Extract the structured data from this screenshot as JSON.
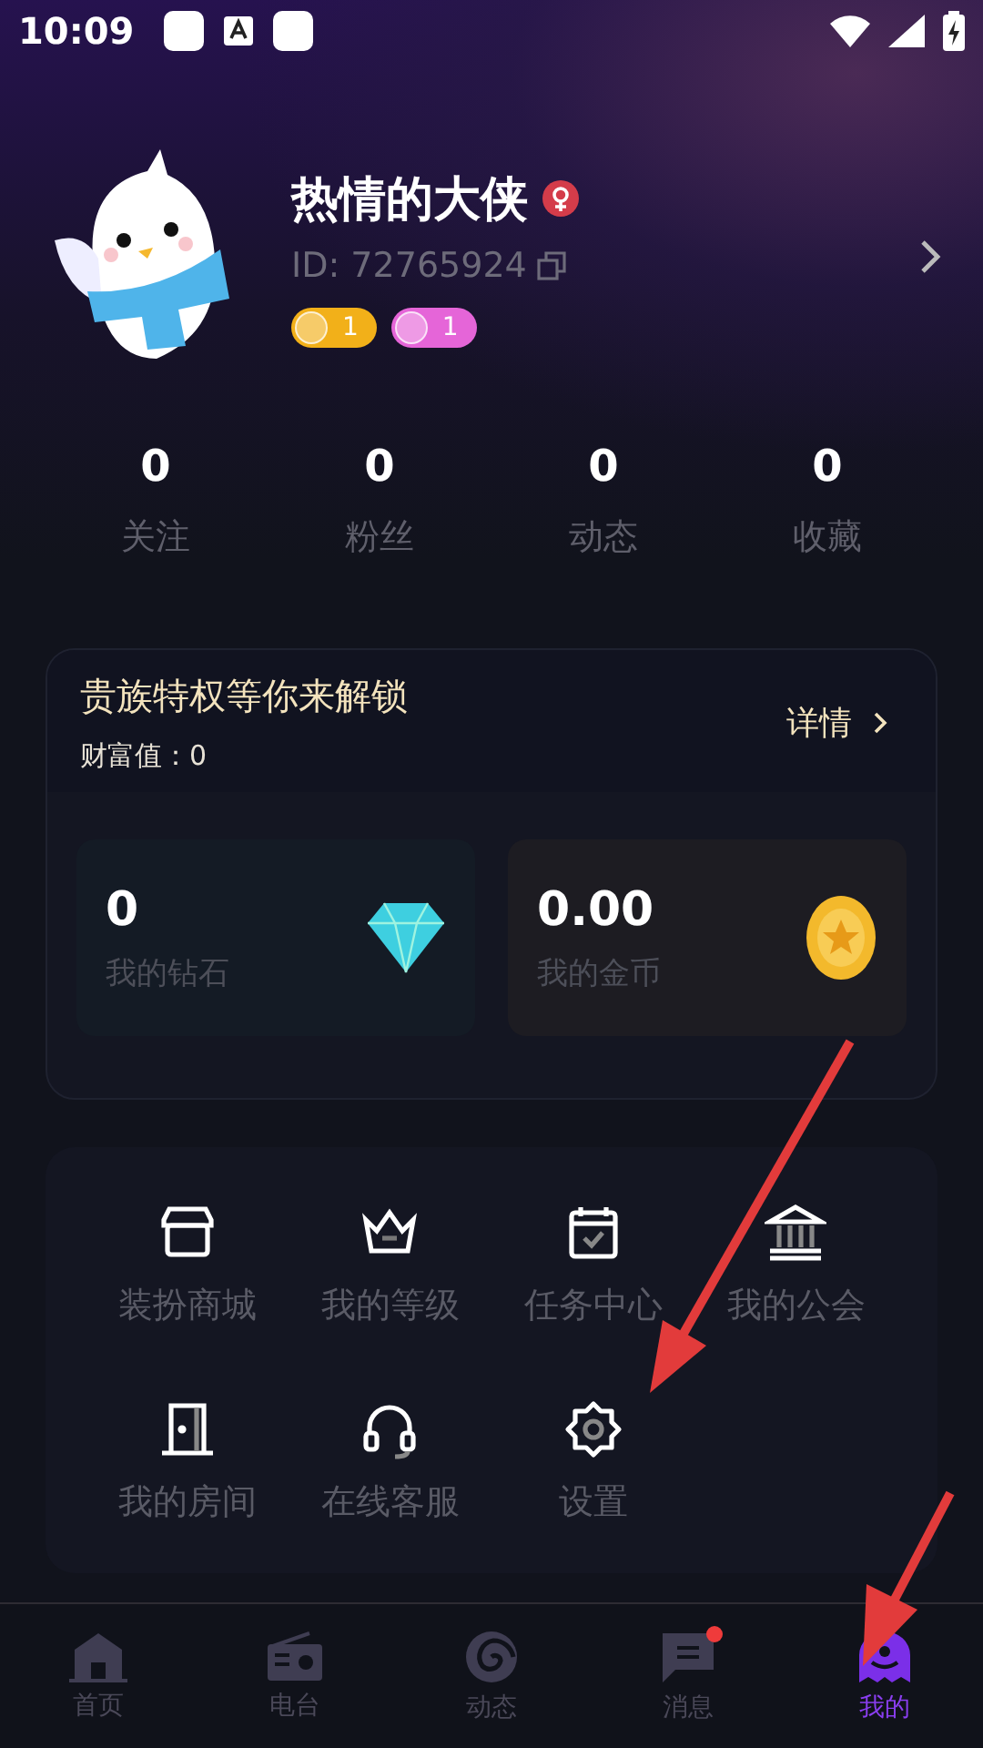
{
  "status_bar": {
    "time": "10:09"
  },
  "profile": {
    "name": "热情的大侠",
    "id": "ID: 72765924",
    "badges": [
      {
        "label": "1",
        "color": "#f2b019"
      },
      {
        "label": "1",
        "color": "#e565d8"
      }
    ]
  },
  "stats": [
    {
      "value": "0",
      "label": "关注"
    },
    {
      "value": "0",
      "label": "粉丝"
    },
    {
      "value": "0",
      "label": "动态"
    },
    {
      "value": "0",
      "label": "收藏"
    }
  ],
  "privilege_card": {
    "title": "贵族特权等你来解锁",
    "wealth": "财富值：0",
    "details": "详情"
  },
  "wallet": [
    {
      "kind": "diamond",
      "value": "0",
      "label": "我的钻石"
    },
    {
      "kind": "coin",
      "value": "0.00",
      "label": "我的金币"
    }
  ],
  "menu": [
    {
      "label": "装扮商城"
    },
    {
      "label": "我的等级"
    },
    {
      "label": "任务中心"
    },
    {
      "label": "我的公会"
    },
    {
      "label": "我的房间"
    },
    {
      "label": "在线客服"
    },
    {
      "label": "设置"
    }
  ],
  "nav": [
    {
      "label": "首页",
      "selected": false,
      "dot": false
    },
    {
      "label": "电台",
      "selected": false,
      "dot": false
    },
    {
      "label": "动态",
      "selected": false,
      "dot": false
    },
    {
      "label": "消息",
      "selected": false,
      "dot": true
    },
    {
      "label": "我的",
      "selected": true,
      "dot": false
    }
  ]
}
